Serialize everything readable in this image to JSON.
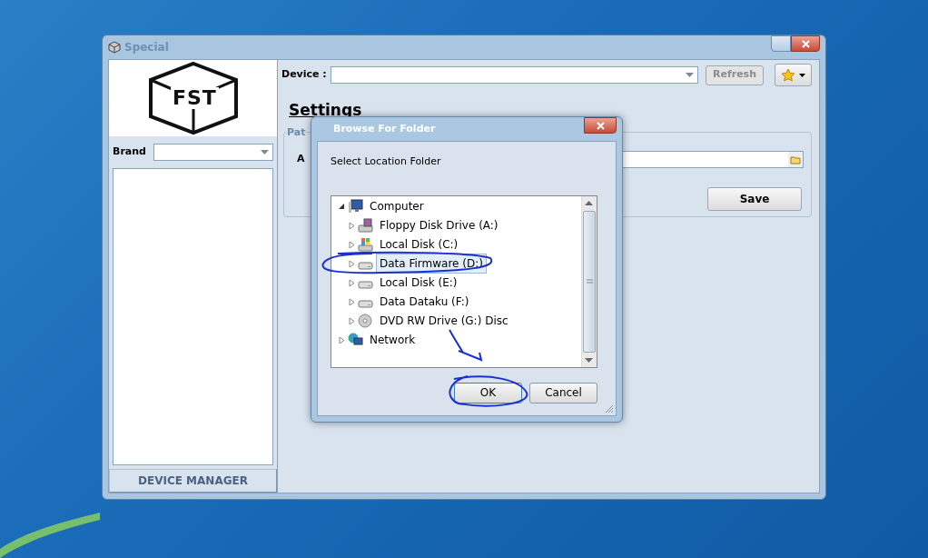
{
  "window": {
    "title": "Special",
    "logo_text": "FST"
  },
  "sidebar": {
    "brand_label": "Brand",
    "button": "DEVICE MANAGER"
  },
  "toolbar": {
    "device_label": "Device :",
    "refresh": "Refresh",
    "refresh_disabled": true
  },
  "settings": {
    "heading": "Settings",
    "group_label": "Pat",
    "field_label": "A",
    "save": "Save"
  },
  "dialog": {
    "title": "Browse For Folder",
    "prompt": "Select Location Folder",
    "tree": [
      {
        "label": "Computer",
        "kind": "computer",
        "expanded": true,
        "selected": false,
        "children": [
          {
            "label": "Floppy Disk Drive (A:)",
            "kind": "floppy",
            "expanded": false,
            "selected": false
          },
          {
            "label": "Local Disk (C:)",
            "kind": "system",
            "expanded": false,
            "selected": false
          },
          {
            "label": "Data Firmware (D:)",
            "kind": "disk",
            "expanded": false,
            "selected": true
          },
          {
            "label": "Local Disk (E:)",
            "kind": "disk",
            "expanded": false,
            "selected": false
          },
          {
            "label": "Data Dataku (F:)",
            "kind": "disk",
            "expanded": false,
            "selected": false
          },
          {
            "label": "DVD RW Drive (G:) Disc",
            "kind": "dvd",
            "expanded": false,
            "selected": false
          }
        ]
      },
      {
        "label": "Network",
        "kind": "network",
        "expanded": false,
        "selected": false
      }
    ],
    "buttons": [
      {
        "label": "OK",
        "kind": "default"
      },
      {
        "label": "Cancel",
        "kind": "normal"
      }
    ]
  }
}
